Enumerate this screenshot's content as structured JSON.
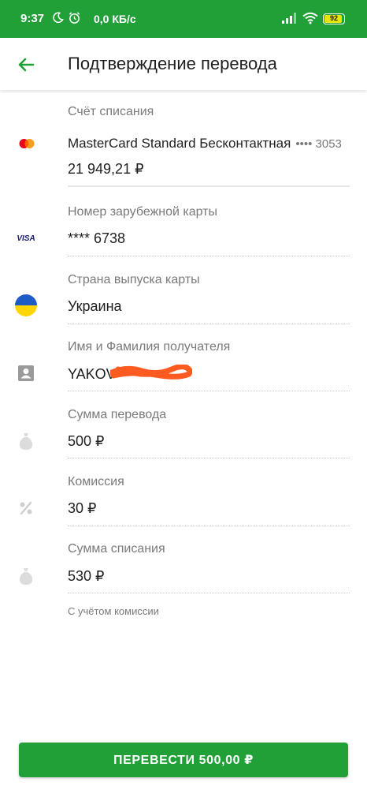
{
  "status_bar": {
    "time": "9:37",
    "net_speed": "0,0 КБ/с",
    "battery": "92",
    "battery_level_percent": 92,
    "color": "#21a038"
  },
  "header": {
    "title": "Подтверждение перевода",
    "back_icon": "arrow-left-icon"
  },
  "rows": [
    {
      "label": "Счёт списания",
      "value": "MasterCard Standard Бесконтактная",
      "value_extra": "•••• 3053",
      "value2": "21 949,21 ₽",
      "icon": "mastercard-icon"
    },
    {
      "label": "Номер зарубежной карты",
      "value": "**** 6738",
      "icon": "visa-icon",
      "icon_text": "VISA"
    },
    {
      "label": "Страна выпуска карты",
      "value": "Украина",
      "icon": "ukraine-flag-icon"
    },
    {
      "label": "Имя и Фамилия получателя",
      "value": "YAKOV",
      "icon": "contact-card-icon"
    },
    {
      "label": "Сумма перевода",
      "value": "500 ₽",
      "icon": "money-bag-icon"
    },
    {
      "label": "Комиссия",
      "value": "30 ₽",
      "icon": "percent-icon"
    },
    {
      "label": "Сумма списания",
      "value": "530 ₽",
      "icon": "money-bag-icon",
      "note": "С учётом комиссии"
    }
  ],
  "submit_button": {
    "label": "ПЕРЕВЕСТИ 500,00 ₽"
  },
  "colors": {
    "accent": "#21a038",
    "label": "#7a7a7a",
    "text": "#1f1f1f",
    "redaction": "#ff5a1f"
  }
}
